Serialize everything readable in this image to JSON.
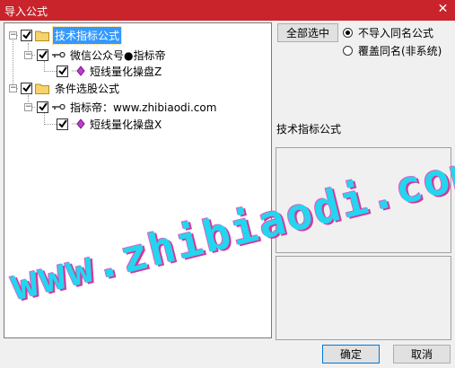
{
  "window": {
    "title": "导入公式",
    "close_symbol": "✕"
  },
  "tree": {
    "nodes": [
      {
        "label": "技术指标公式",
        "checked": true,
        "selected": true
      },
      {
        "label": "微信公众号●指标帝",
        "checked": true
      },
      {
        "label": "短线量化操盘Z",
        "checked": true
      },
      {
        "label": "条件选股公式",
        "checked": true
      },
      {
        "label": "指标帝：www.zhibiaodi.com",
        "checked": true
      },
      {
        "label": "短线量化操盘X",
        "checked": true
      }
    ]
  },
  "options": {
    "select_all_label": "全部选中",
    "radio_no_import": "不导入同名公式",
    "radio_overwrite": "覆盖同名(非系统)",
    "selected_radio": "radio_no_import"
  },
  "detail": {
    "section_label": "技术指标公式"
  },
  "buttons": {
    "ok_label": "确定",
    "cancel_label": "取消"
  },
  "watermark": {
    "text": "www.zhibiaodi.com"
  },
  "colors": {
    "title_bar": "#c9242b",
    "selection": "#3399ff",
    "watermark": "#22d6f0"
  }
}
